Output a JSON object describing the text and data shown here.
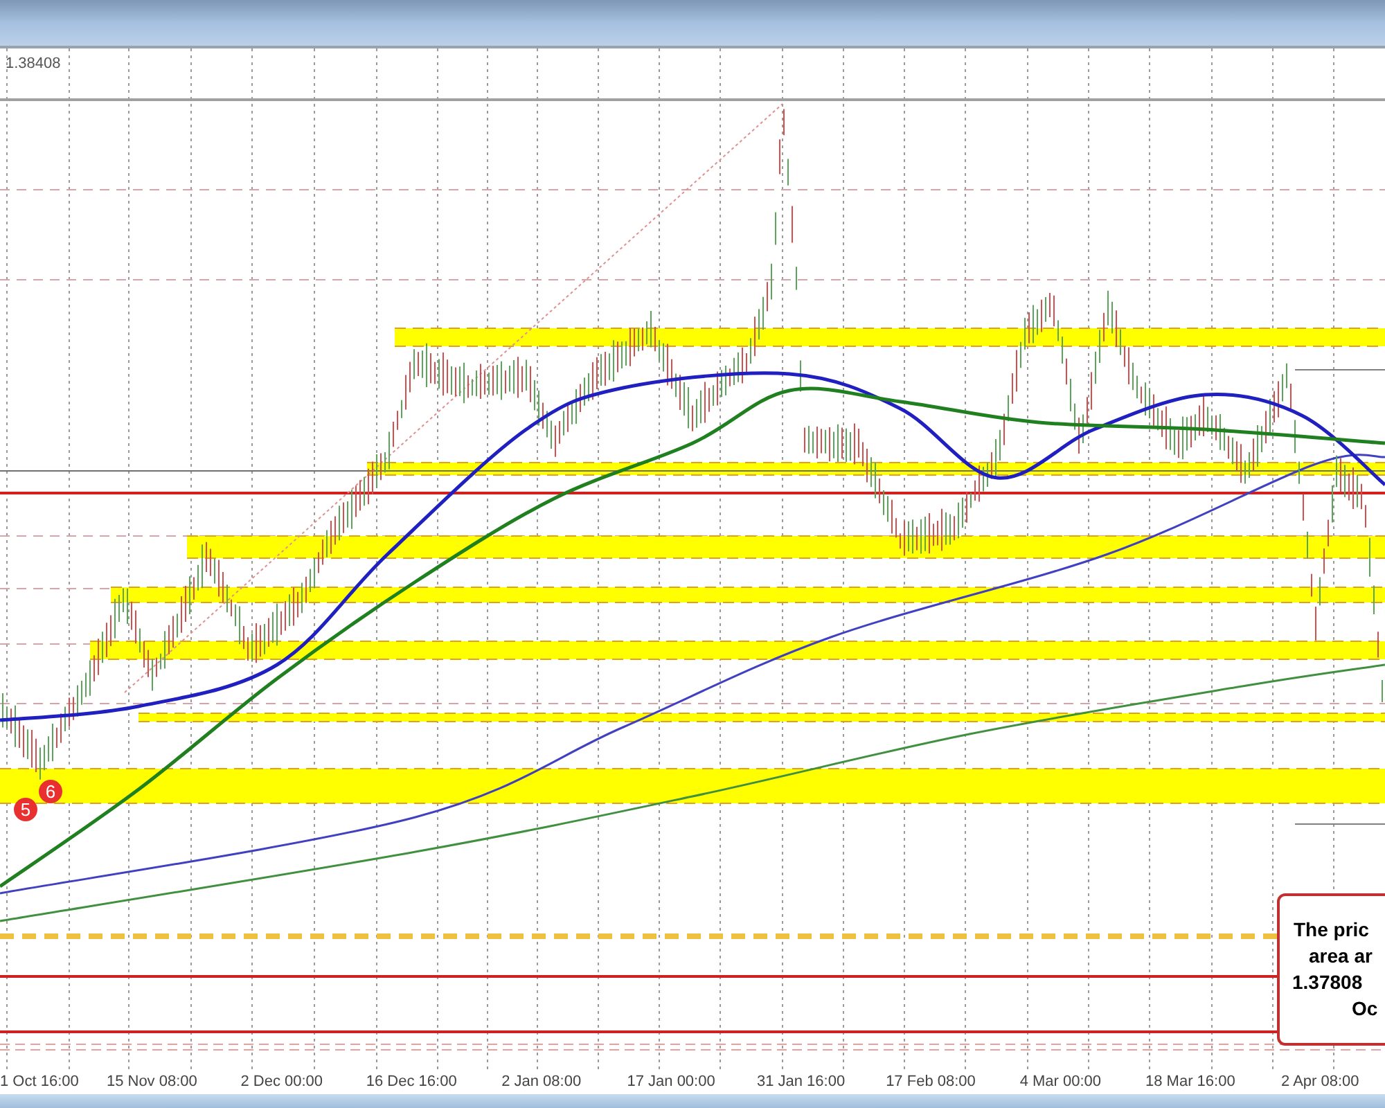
{
  "chart": {
    "price_label": "1.38408",
    "markers": [
      "5",
      "6"
    ],
    "annotation": {
      "lines": [
        "The pric",
        "area ar",
        "1.37808",
        "Oc"
      ]
    }
  },
  "x_axis": {
    "labels": [
      "1 Oct 16:00",
      "15 Nov 08:00",
      "2 Dec 00:00",
      "16 Dec 16:00",
      "2 Jan 08:00",
      "17 Jan 00:00",
      "31 Jan 16:00",
      "17 Feb 08:00",
      "4 Mar 00:00",
      "18 Mar 16:00",
      "2 Apr 08:00"
    ]
  }
}
